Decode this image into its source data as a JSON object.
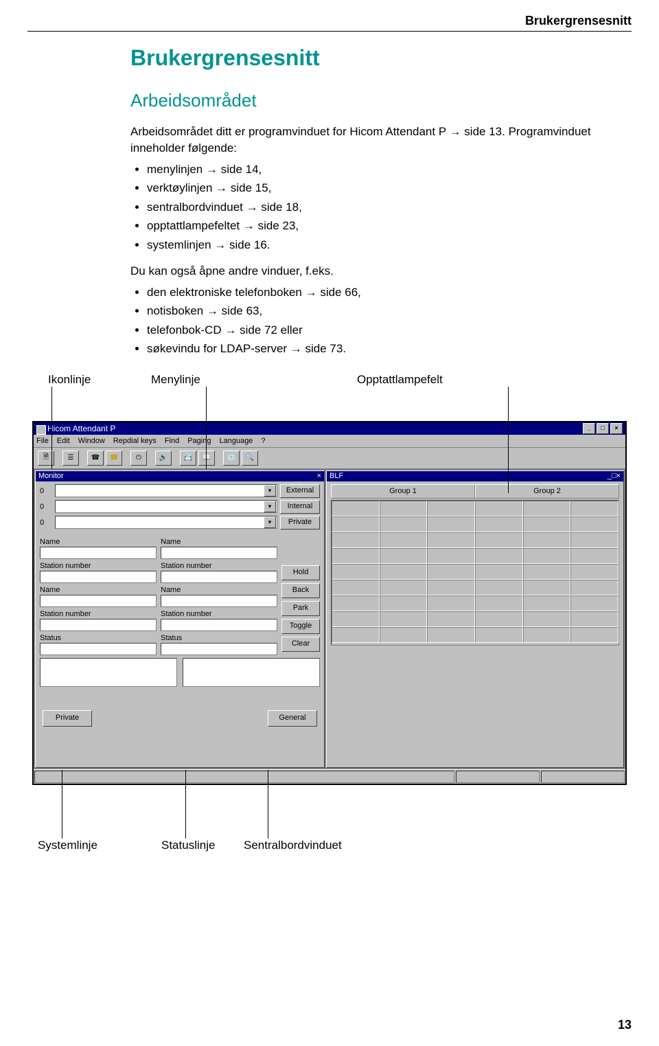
{
  "header": {
    "running": "Brukergrensesnitt"
  },
  "title": "Brukergrensesnitt",
  "subtitle": "Arbeidsområdet",
  "intro": "Arbeidsområdet ditt er programvinduet for Hicom Attendant P → side 13. Programvinduet inneholder følgende:",
  "list1": {
    "i0": "menylinjen → side 14,",
    "i1": "verktøylinjen → side 15,",
    "i2": "sentralbordvinduet → side 18,",
    "i3": "opptattlampefeltet → side 23,",
    "i4": "systemlinjen → side 16."
  },
  "para2": "Du kan også åpne andre vinduer, f.eks.",
  "list2": {
    "i0": "den elektroniske telefonboken → side 66,",
    "i1": "notisboken → side 63,",
    "i2": "telefonbok-CD → side 72 eller",
    "i3": "søkevindu for LDAP-server → side 73."
  },
  "callouts": {
    "top1": "Ikonlinje",
    "top2": "Menylinje",
    "top3": "Opptattlampefelt",
    "bot1": "Systemlinje",
    "bot2": "Statuslinje",
    "bot3": "Sentralbordvinduet"
  },
  "screenshot": {
    "window_title": "Hicom Attendant P",
    "menu": {
      "m0": "File",
      "m1": "Edit",
      "m2": "Window",
      "m3": "Repdial keys",
      "m4": "Find",
      "m5": "Paging",
      "m6": "Language",
      "m7": "?"
    },
    "monitor": {
      "title": "Monitor",
      "row1_num": "0",
      "row1_btn": "External",
      "row2_num": "0",
      "row2_btn": "Internal",
      "row3_num": "0",
      "row3_btn": "Private",
      "labels": {
        "name": "Name",
        "station": "Station number",
        "status": "Status"
      },
      "actions": {
        "hold": "Hold",
        "back": "Back",
        "park": "Park",
        "toggle": "Toggle",
        "clear": "Clear"
      },
      "bottom": {
        "private": "Private",
        "general": "General"
      }
    },
    "blf": {
      "title": "BLF",
      "tab1": "Group 1",
      "tab2": "Group 2"
    },
    "winctrl": {
      "min": "_",
      "max": "□",
      "close": "×"
    }
  },
  "page_number": "13"
}
